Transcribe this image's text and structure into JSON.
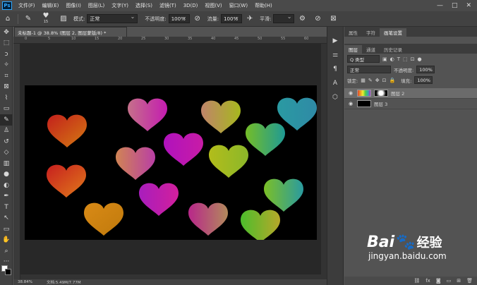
{
  "menu": {
    "logo": "Ps",
    "items": [
      "文件(F)",
      "编辑(E)",
      "图像(I)",
      "图层(L)",
      "文字(Y)",
      "选择(S)",
      "滤镜(T)",
      "3D(D)",
      "视图(V)",
      "窗口(W)",
      "帮助(H)"
    ],
    "window_buttons": [
      "—",
      "□",
      "✕"
    ]
  },
  "options": {
    "brush_size": "15",
    "mode_label": "模式:",
    "mode_value": "正常",
    "opacity_label": "不透明度:",
    "opacity_value": "100%",
    "flow_label": "流量:",
    "flow_value": "100%",
    "smooth_label": "平滑:"
  },
  "document": {
    "tab_title": "未标题-1 @ 38.8% (图层 2, 图层蒙版/8) *",
    "ruler_numbers": [
      "0",
      "5",
      "10",
      "15",
      "20",
      "25",
      "30",
      "35",
      "40",
      "45",
      "50",
      "55",
      "60"
    ],
    "status_zoom": "38.84%",
    "status_doc": "文档:5.49M/7.77M"
  },
  "panel": {
    "top_tabs": [
      "属性",
      "字符",
      "画笔设置"
    ],
    "tabs": [
      "图层",
      "通道",
      "历史记录"
    ],
    "filter_label": "Q 类型",
    "blend_mode": "正常",
    "opacity_label": "不透明度:",
    "opacity_value": "100%",
    "lock_label": "锁定:",
    "fill_label": "填充:",
    "fill_value": "100%",
    "layers": [
      {
        "name": "图层 2"
      },
      {
        "name": "图层 3"
      }
    ]
  },
  "watermark": {
    "brand": "Bai",
    "brand_cn": "经验",
    "url": "jingyan.baidu.com"
  },
  "colors": {
    "canvas_bg": "#000000",
    "ui_dark": "#424242",
    "selected_layer": "#6b6b6b"
  }
}
